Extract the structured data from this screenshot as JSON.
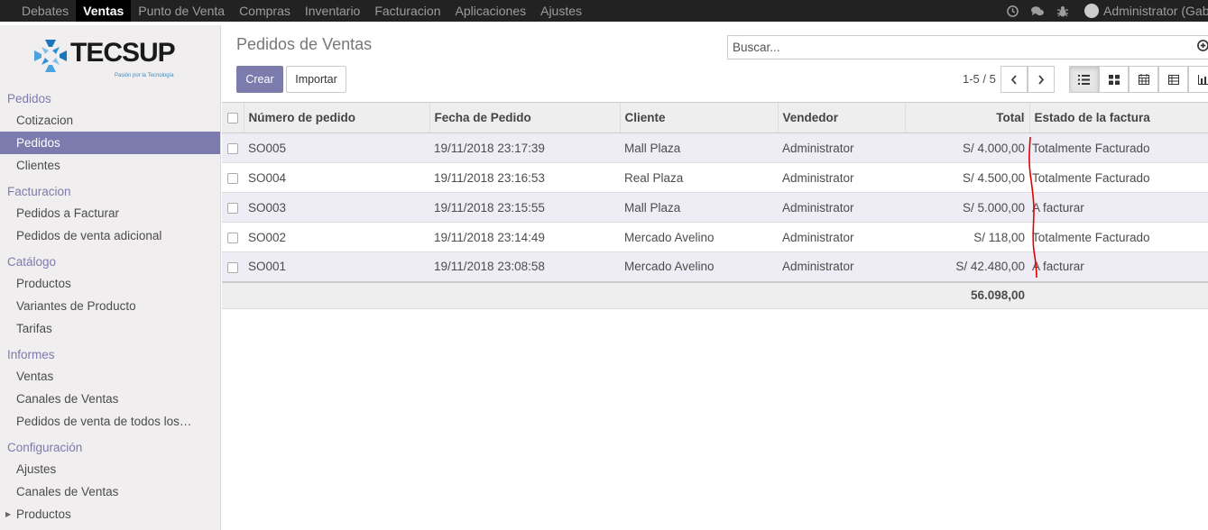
{
  "topbar": {
    "menu": [
      "Debates",
      "Ventas",
      "Punto de Venta",
      "Compras",
      "Inventario",
      "Facturacion",
      "Aplicaciones",
      "Ajustes"
    ],
    "active_index": 1,
    "user": "Administrator (Gabb"
  },
  "logo": {
    "text": "TECSUP",
    "tagline": "Pasión por la Tecnología"
  },
  "sidebar": {
    "sections": [
      {
        "title": "Pedidos",
        "items": [
          "Cotizacion",
          "Pedidos",
          "Clientes"
        ]
      },
      {
        "title": "Facturacion",
        "items": [
          "Pedidos a Facturar",
          "Pedidos de venta adicional"
        ]
      },
      {
        "title": "Catálogo",
        "items": [
          "Productos",
          "Variantes de Producto",
          "Tarifas"
        ]
      },
      {
        "title": "Informes",
        "items": [
          "Ventas",
          "Canales de Ventas",
          "Pedidos de venta de todos los…"
        ]
      },
      {
        "title": "Configuración",
        "items": [
          "Ajustes",
          "Canales de Ventas",
          "Productos"
        ]
      }
    ],
    "active_item": "Pedidos"
  },
  "control": {
    "breadcrumb": "Pedidos de Ventas",
    "search_placeholder": "Buscar...",
    "create_label": "Crear",
    "import_label": "Importar",
    "pager": "1-5 / 5"
  },
  "table": {
    "headers": [
      "Número de pedido",
      "Fecha de Pedido",
      "Cliente",
      "Vendedor",
      "Total",
      "Estado de la factura"
    ],
    "rows": [
      [
        "SO005",
        "19/11/2018 23:17:39",
        "Mall Plaza",
        "Administrator",
        "S/ 4.000,00",
        "Totalmente Facturado"
      ],
      [
        "SO004",
        "19/11/2018 23:16:53",
        "Real Plaza",
        "Administrator",
        "S/ 4.500,00",
        "Totalmente Facturado"
      ],
      [
        "SO003",
        "19/11/2018 23:15:55",
        "Mall Plaza",
        "Administrator",
        "S/ 5.000,00",
        "A facturar"
      ],
      [
        "SO002",
        "19/11/2018 23:14:49",
        "Mercado Avelino",
        "Administrator",
        "S/ 118,00",
        "Totalmente Facturado"
      ],
      [
        "SO001",
        "19/11/2018 23:08:58",
        "Mercado Avelino",
        "Administrator",
        "S/ 42.480,00",
        "A facturar"
      ]
    ],
    "total": "56.098,00"
  },
  "colors": {
    "accent": "#7c7bad",
    "topbar": "#222222",
    "annotation": "#e00000"
  }
}
